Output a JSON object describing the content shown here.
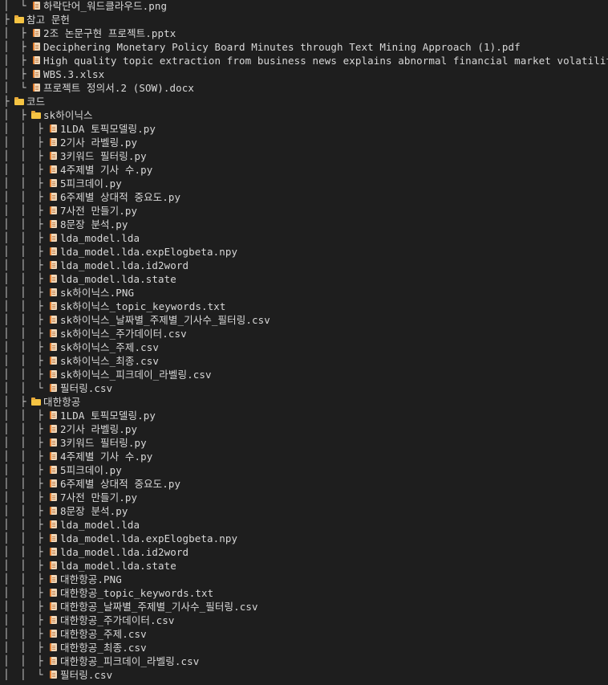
{
  "tree": [
    {
      "guides": [
        "│",
        "└"
      ],
      "type": "file",
      "name": "하락단어_워드클라우드.png"
    },
    {
      "guides": [
        "├"
      ],
      "type": "folder",
      "name": "참고 문헌"
    },
    {
      "guides": [
        "│",
        "├"
      ],
      "type": "file",
      "name": "2조 논문구현 프로젝트.pptx"
    },
    {
      "guides": [
        "│",
        "├"
      ],
      "type": "file",
      "name": "Deciphering Monetary Policy Board Minutes through Text Mining Approach (1).pdf"
    },
    {
      "guides": [
        "│",
        "├"
      ],
      "type": "file",
      "name": "High quality topic extraction from business news explains abnormal financial market volatility.pdf"
    },
    {
      "guides": [
        "│",
        "├"
      ],
      "type": "file",
      "name": "WBS.3.xlsx"
    },
    {
      "guides": [
        "│",
        "└"
      ],
      "type": "file",
      "name": "프로젝트 정의서.2 (SOW).docx"
    },
    {
      "guides": [
        "├"
      ],
      "type": "folder",
      "name": "코드"
    },
    {
      "guides": [
        "│",
        "├"
      ],
      "type": "folder",
      "name": "sk하이닉스"
    },
    {
      "guides": [
        "│",
        "│",
        "├"
      ],
      "type": "file",
      "name": "1LDA 토픽모델링.py"
    },
    {
      "guides": [
        "│",
        "│",
        "├"
      ],
      "type": "file",
      "name": "2기사 라벨링.py"
    },
    {
      "guides": [
        "│",
        "│",
        "├"
      ],
      "type": "file",
      "name": "3키워드 필터링.py"
    },
    {
      "guides": [
        "│",
        "│",
        "├"
      ],
      "type": "file",
      "name": "4주제별 기사 수.py"
    },
    {
      "guides": [
        "│",
        "│",
        "├"
      ],
      "type": "file",
      "name": "5피크데이.py"
    },
    {
      "guides": [
        "│",
        "│",
        "├"
      ],
      "type": "file",
      "name": "6주제별 상대적 중요도.py"
    },
    {
      "guides": [
        "│",
        "│",
        "├"
      ],
      "type": "file",
      "name": "7사전 만들기.py"
    },
    {
      "guides": [
        "│",
        "│",
        "├"
      ],
      "type": "file",
      "name": "8문장 분석.py"
    },
    {
      "guides": [
        "│",
        "│",
        "├"
      ],
      "type": "file",
      "name": "lda_model.lda"
    },
    {
      "guides": [
        "│",
        "│",
        "├"
      ],
      "type": "file",
      "name": "lda_model.lda.expElogbeta.npy"
    },
    {
      "guides": [
        "│",
        "│",
        "├"
      ],
      "type": "file",
      "name": "lda_model.lda.id2word"
    },
    {
      "guides": [
        "│",
        "│",
        "├"
      ],
      "type": "file",
      "name": "lda_model.lda.state"
    },
    {
      "guides": [
        "│",
        "│",
        "├"
      ],
      "type": "file",
      "name": "sk하이닉스.PNG"
    },
    {
      "guides": [
        "│",
        "│",
        "├"
      ],
      "type": "file",
      "name": "sk하이닉스_topic_keywords.txt"
    },
    {
      "guides": [
        "│",
        "│",
        "├"
      ],
      "type": "file",
      "name": "sk하이닉스_날짜별_주제별_기사수_필터링.csv"
    },
    {
      "guides": [
        "│",
        "│",
        "├"
      ],
      "type": "file",
      "name": "sk하이닉스_주가데이터.csv"
    },
    {
      "guides": [
        "│",
        "│",
        "├"
      ],
      "type": "file",
      "name": "sk하이닉스_주제.csv"
    },
    {
      "guides": [
        "│",
        "│",
        "├"
      ],
      "type": "file",
      "name": "sk하이닉스_최종.csv"
    },
    {
      "guides": [
        "│",
        "│",
        "├"
      ],
      "type": "file",
      "name": "sk하이닉스_피크데이_라벨링.csv"
    },
    {
      "guides": [
        "│",
        "│",
        "└"
      ],
      "type": "file",
      "name": "필터링.csv"
    },
    {
      "guides": [
        "│",
        "├"
      ],
      "type": "folder",
      "name": "대한항공"
    },
    {
      "guides": [
        "│",
        "│",
        "├"
      ],
      "type": "file",
      "name": "1LDA 토픽모델링.py"
    },
    {
      "guides": [
        "│",
        "│",
        "├"
      ],
      "type": "file",
      "name": "2기사 라벨링.py"
    },
    {
      "guides": [
        "│",
        "│",
        "├"
      ],
      "type": "file",
      "name": "3키워드 필터링.py"
    },
    {
      "guides": [
        "│",
        "│",
        "├"
      ],
      "type": "file",
      "name": "4주제별 기사 수.py"
    },
    {
      "guides": [
        "│",
        "│",
        "├"
      ],
      "type": "file",
      "name": "5피크데이.py"
    },
    {
      "guides": [
        "│",
        "│",
        "├"
      ],
      "type": "file",
      "name": "6주제별 상대적 중요도.py"
    },
    {
      "guides": [
        "│",
        "│",
        "├"
      ],
      "type": "file",
      "name": "7사전 만들기.py"
    },
    {
      "guides": [
        "│",
        "│",
        "├"
      ],
      "type": "file",
      "name": "8문장 분석.py"
    },
    {
      "guides": [
        "│",
        "│",
        "├"
      ],
      "type": "file",
      "name": "lda_model.lda"
    },
    {
      "guides": [
        "│",
        "│",
        "├"
      ],
      "type": "file",
      "name": "lda_model.lda.expElogbeta.npy"
    },
    {
      "guides": [
        "│",
        "│",
        "├"
      ],
      "type": "file",
      "name": "lda_model.lda.id2word"
    },
    {
      "guides": [
        "│",
        "│",
        "├"
      ],
      "type": "file",
      "name": "lda_model.lda.state"
    },
    {
      "guides": [
        "│",
        "│",
        "├"
      ],
      "type": "file",
      "name": "대한항공.PNG"
    },
    {
      "guides": [
        "│",
        "│",
        "├"
      ],
      "type": "file",
      "name": "대한항공_topic_keywords.txt"
    },
    {
      "guides": [
        "│",
        "│",
        "├"
      ],
      "type": "file",
      "name": "대한항공_날짜별_주제별_기사수_필터링.csv"
    },
    {
      "guides": [
        "│",
        "│",
        "├"
      ],
      "type": "file",
      "name": "대한항공_주가데이터.csv"
    },
    {
      "guides": [
        "│",
        "│",
        "├"
      ],
      "type": "file",
      "name": "대한항공_주제.csv"
    },
    {
      "guides": [
        "│",
        "│",
        "├"
      ],
      "type": "file",
      "name": "대한항공_최종.csv"
    },
    {
      "guides": [
        "│",
        "│",
        "├"
      ],
      "type": "file",
      "name": "대한항공_피크데이_라벨링.csv"
    },
    {
      "guides": [
        "│",
        "│",
        "└"
      ],
      "type": "file",
      "name": "필터링.csv"
    }
  ]
}
